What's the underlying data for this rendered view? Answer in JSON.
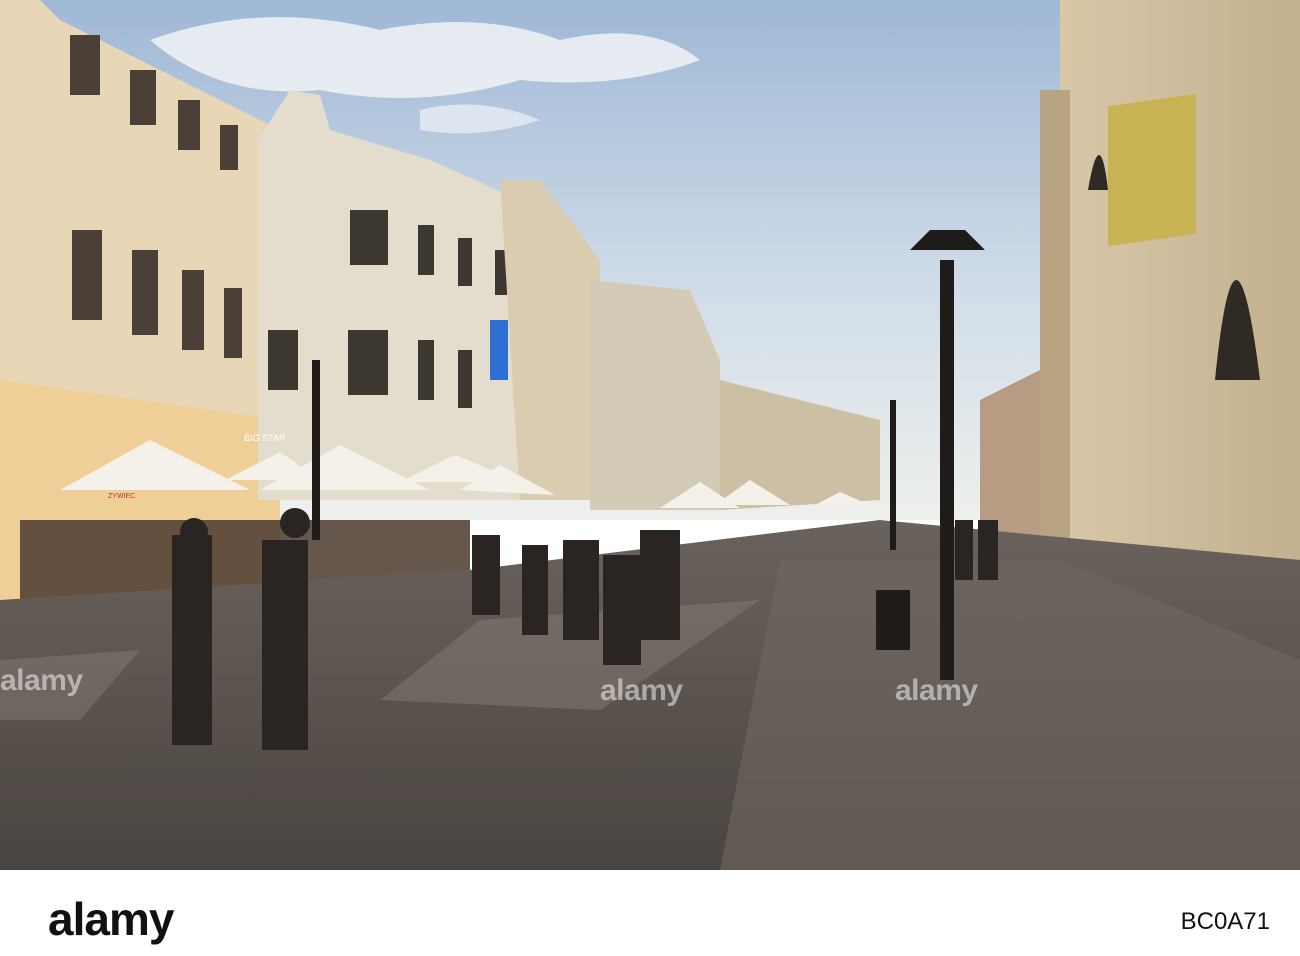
{
  "watermark": {
    "text": "alamy"
  },
  "signs": {
    "big_star": "BIG STAR",
    "zywiec": "ZYWIEC"
  },
  "footer": {
    "logo": "alamy",
    "image_id": "BC0A71"
  },
  "colors": {
    "sky": "#b7cbe0",
    "pavement": "#5a5450",
    "building_light": "#e6d8bd",
    "shadow_building": "#d7c6a5"
  }
}
